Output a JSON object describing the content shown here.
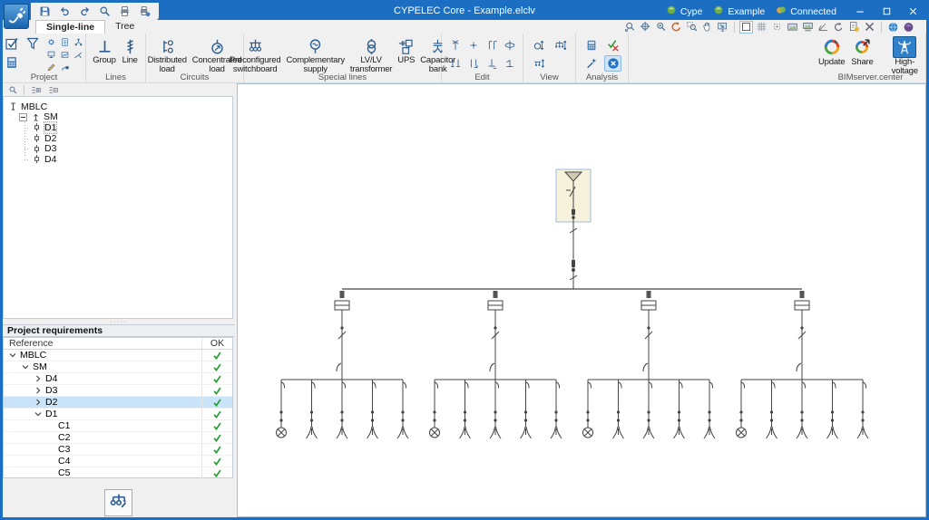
{
  "window": {
    "title": "CYPELEC Core - Example.elclv",
    "titlebar_items": [
      {
        "label": "Cype",
        "icon": "sphere-green"
      },
      {
        "label": "Example",
        "icon": "sphere-green"
      },
      {
        "label": "Connected",
        "icon": "connected"
      }
    ],
    "controls": [
      {
        "name": "minimize",
        "icon": "win-min"
      },
      {
        "name": "maximize",
        "icon": "win-max"
      },
      {
        "name": "close",
        "icon": "win-close"
      }
    ]
  },
  "quick_access": [
    "save",
    "undo",
    "redo",
    "zoom-search",
    "print",
    "print-setup"
  ],
  "tabs": [
    {
      "label": "Single-line",
      "active": true
    },
    {
      "label": "Tree",
      "active": false
    }
  ],
  "view_toolbar": [
    "zoom-prev",
    "zoom-extents",
    "zoom-object",
    "redraw",
    "zoom-window",
    "pan",
    "full-screen"
  ],
  "draw_toolbar": [
    {
      "icon": "frame",
      "selected": true
    },
    {
      "icon": "grid"
    },
    {
      "icon": "snap"
    },
    {
      "icon": "image"
    },
    {
      "icon": "image-label"
    },
    {
      "icon": "protractor"
    },
    {
      "icon": "rotate"
    },
    {
      "icon": "sheet"
    },
    {
      "icon": "tools-x"
    }
  ],
  "web_toolbar": [
    "globe-blue",
    "globe-purple"
  ],
  "ribbon": {
    "groups": [
      {
        "label": "Project",
        "type": "project",
        "big_icons": [
          "tasks-check",
          "calculator"
        ],
        "mid_icon": "funnel",
        "small_icons": [
          "gear",
          "doc",
          "net",
          "monitor",
          "img",
          "ramp",
          "pencil",
          "plugpen"
        ]
      },
      {
        "label": "Lines",
        "type": "big",
        "buttons": [
          {
            "label": "Group",
            "icon": "group"
          },
          {
            "label": "Line",
            "icon": "line"
          }
        ]
      },
      {
        "label": "Circuits",
        "type": "big",
        "buttons": [
          {
            "label": "Distributed load",
            "icon": "distributed-load"
          },
          {
            "label": "Concentrated load",
            "icon": "concentrated-load"
          }
        ]
      },
      {
        "label": "Special lines",
        "type": "big",
        "buttons": [
          {
            "label": "Preconfigured switchboard",
            "icon": "preconfigured-switchboard"
          },
          {
            "label": "Complementary supply",
            "icon": "complementary-supply"
          },
          {
            "label": "LV/LV transformer",
            "icon": "lvlv-transformer"
          },
          {
            "label": "UPS",
            "icon": "ups"
          },
          {
            "label": "Capacitor bank",
            "icon": "capacitor-bank"
          }
        ]
      },
      {
        "label": "Edit",
        "type": "grid",
        "cols": 4,
        "icons": [
          {
            "icon": "edit-terminal"
          },
          {
            "icon": "edit-spark"
          },
          {
            "icon": "edit-pins"
          },
          {
            "icon": "edit-loop"
          },
          {
            "icon": "edit-forks"
          },
          {
            "icon": "edit-pin"
          },
          {
            "icon": "edit-ground"
          },
          {
            "icon": "edit-tee"
          }
        ]
      },
      {
        "label": "View",
        "type": "grid",
        "cols": 2,
        "icons": [
          {
            "icon": "view-zoom-object"
          },
          {
            "icon": "view-zoom-tree"
          },
          {
            "icon": "view-zoom-bus"
          }
        ]
      },
      {
        "label": "Analysis",
        "type": "grid",
        "cols": 2,
        "icons": [
          {
            "icon": "calculator"
          },
          {
            "icon": "check-x"
          },
          {
            "icon": "wand"
          },
          {
            "icon": "cancel",
            "selected": true
          }
        ]
      },
      {
        "label": "BIMserver.center",
        "type": "bim",
        "buttons": [
          {
            "label": "Update",
            "icon": "bim-update"
          },
          {
            "label": "Share",
            "icon": "bim-share"
          },
          {
            "label": "High-voltage",
            "icon": "hv-tower",
            "selected": true
          }
        ]
      }
    ]
  },
  "left_panel": {
    "toolbar": [
      "panel-search",
      "tree-expand",
      "tree-collapse"
    ],
    "tree": [
      {
        "label": "MBLC",
        "level": 0,
        "icon": "node-root",
        "expander": "none"
      },
      {
        "label": "SM",
        "level": 1,
        "icon": "node-supply",
        "expander": "minus"
      },
      {
        "label": "D1",
        "level": 2,
        "icon": "node-switch",
        "expander": "none",
        "selected": true
      },
      {
        "label": "D2",
        "level": 2,
        "icon": "node-switch",
        "expander": "none"
      },
      {
        "label": "D3",
        "level": 2,
        "icon": "node-switch",
        "expander": "none"
      },
      {
        "label": "D4",
        "level": 2,
        "icon": "node-switch",
        "expander": "none"
      }
    ],
    "requirements": {
      "title": "Project requirements",
      "columns": [
        "Reference",
        "OK"
      ],
      "rows": [
        {
          "label": "MBLC",
          "level": 0,
          "expander": "open",
          "ok": true
        },
        {
          "label": "SM",
          "level": 1,
          "expander": "open",
          "ok": true
        },
        {
          "label": "D4",
          "level": 2,
          "expander": "closed",
          "ok": true
        },
        {
          "label": "D3",
          "level": 2,
          "expander": "closed",
          "ok": true
        },
        {
          "label": "D2",
          "level": 2,
          "expander": "closed",
          "ok": true,
          "selected": true
        },
        {
          "label": "D1",
          "level": 2,
          "expander": "open",
          "ok": true
        },
        {
          "label": "C1",
          "level": 3,
          "expander": "none",
          "ok": true
        },
        {
          "label": "C2",
          "level": 3,
          "expander": "none",
          "ok": true
        },
        {
          "label": "C3",
          "level": 3,
          "expander": "none",
          "ok": true
        },
        {
          "label": "C4",
          "level": 3,
          "expander": "none",
          "ok": true
        },
        {
          "label": "C5",
          "level": 3,
          "expander": "none",
          "ok": true
        }
      ]
    },
    "bottom_button_icon": "diagram-wand"
  },
  "diagram": {
    "feeder_count": 4,
    "circuits_per_feeder": 5,
    "circuit_terminals": [
      "lamp",
      "socket",
      "socket",
      "socket",
      "socket"
    ],
    "supply_box_color": "#f6f2dc",
    "line_color": "#444444"
  },
  "colors": {
    "titlebar": "#1b6ec2",
    "ribbon_bg": "#f0f0f0",
    "selected_row": "#c9e3f8",
    "check_green": "#1f9d2f",
    "accent_blue": "#2d5e93"
  }
}
